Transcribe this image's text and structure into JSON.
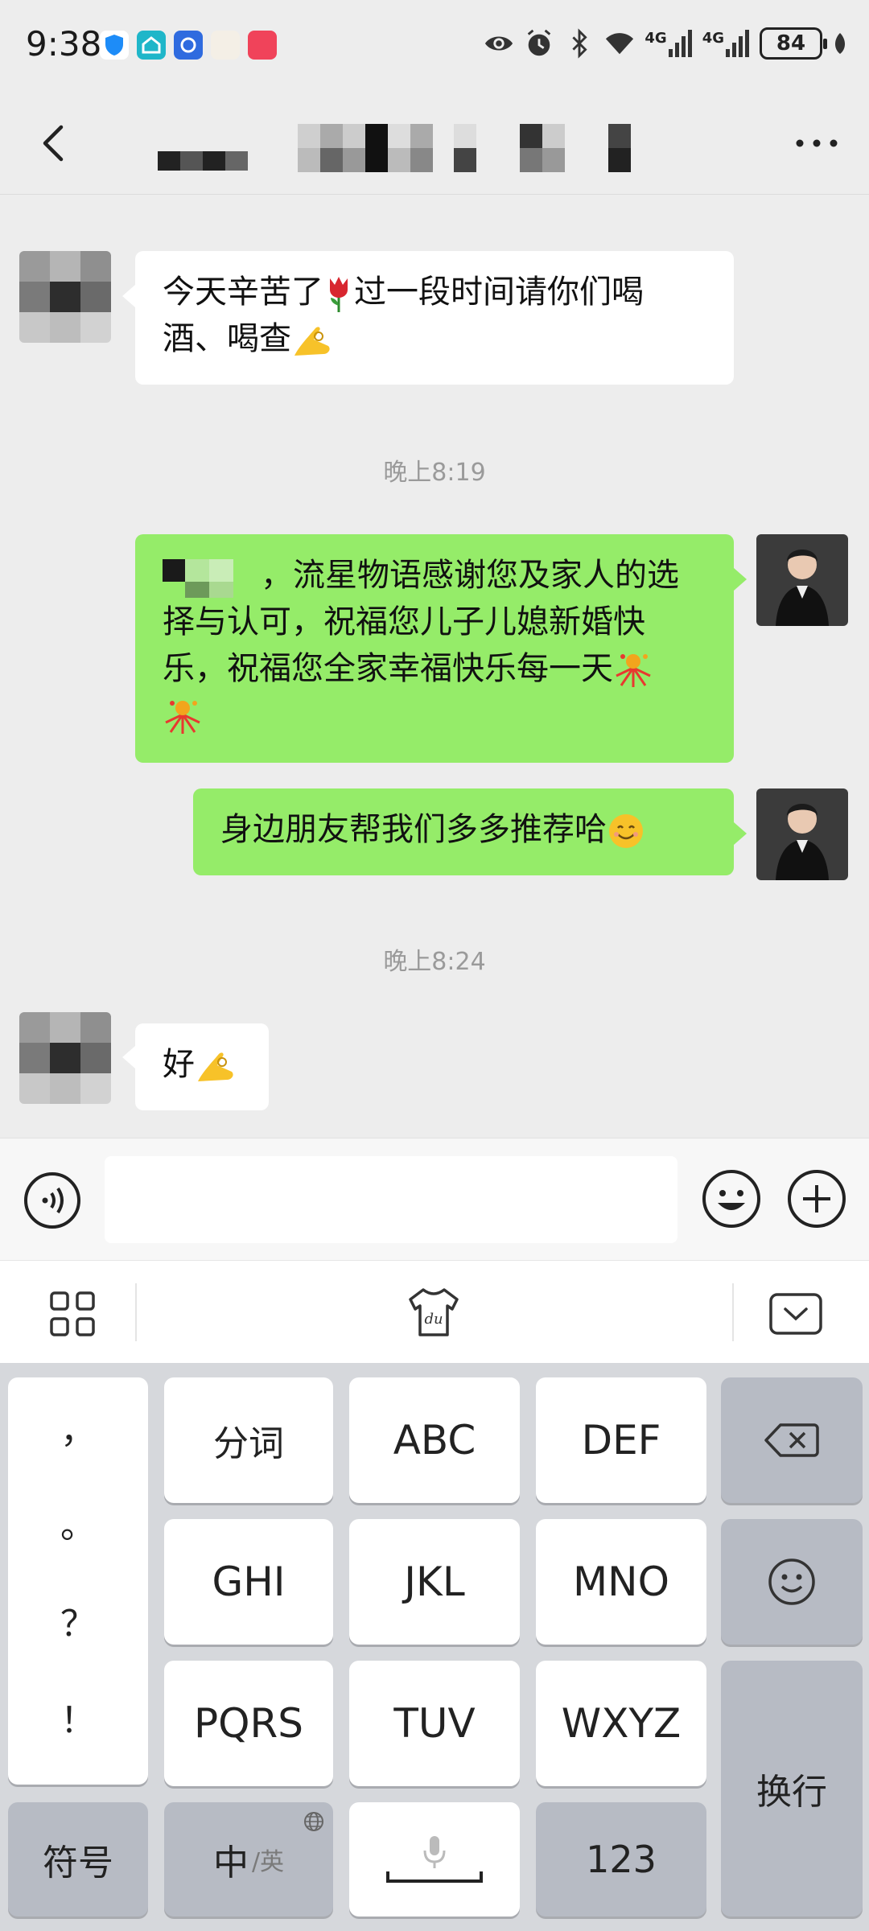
{
  "status_bar": {
    "time": "9:38",
    "network_1": "4G",
    "network_2": "4G",
    "battery": "84"
  },
  "chat": {
    "messages": [
      {
        "direction": "in",
        "text": "今天辛苦了🌷过一段时间请你们喝酒、喝查👌"
      },
      {
        "type": "timestamp",
        "text": "晚上8:19"
      },
      {
        "direction": "out",
        "text": "，流星物语感谢您及家人的选择与认可，祝福您儿子儿媳新婚快乐，祝福您全家幸福快乐每一天🎊🎊"
      },
      {
        "direction": "out",
        "text": "身边朋友帮我们多多推荐哈😊"
      },
      {
        "type": "timestamp",
        "text": "晚上8:24"
      },
      {
        "direction": "in",
        "text": "好👌"
      }
    ],
    "msg1_line1": "今天辛苦了",
    "msg1_line1b": "过一段时间请你们喝",
    "msg1_line2": "酒、喝查",
    "ts1": "晚上8:19",
    "msg2_line1": "，流星物语感谢您及家人的选",
    "msg2_line2": "择与认可，祝福您儿子儿媳新婚快",
    "msg2_line3": "乐，祝福您全家幸福快乐每一天",
    "msg3": "身边朋友帮我们多多推荐哈",
    "ts2": "晚上8:24",
    "msg4": "好"
  },
  "keyboard": {
    "punct": [
      "，",
      "。",
      "？",
      "！"
    ],
    "row1": [
      "分词",
      "ABC",
      "DEF"
    ],
    "row2": [
      "GHI",
      "JKL",
      "MNO"
    ],
    "row3": [
      "PQRS",
      "TUV",
      "WXYZ"
    ],
    "symbols": "符号",
    "zh": "中",
    "zh_sub": "/英",
    "num": "123",
    "enter": "换行"
  },
  "colors": {
    "bg": "#ededed",
    "out_bubble": "#95ec69",
    "in_bubble": "#ffffff",
    "keyboard_bg": "#d6d8dc"
  },
  "icons": [
    "back-arrow-icon",
    "more-dots-icon",
    "voice-icon",
    "emoji-icon",
    "plus-icon",
    "grid-icon",
    "du-shirt-icon",
    "keyboard-hide-icon",
    "backspace-icon",
    "smiley-key-icon",
    "mic-icon",
    "globe-icon"
  ]
}
